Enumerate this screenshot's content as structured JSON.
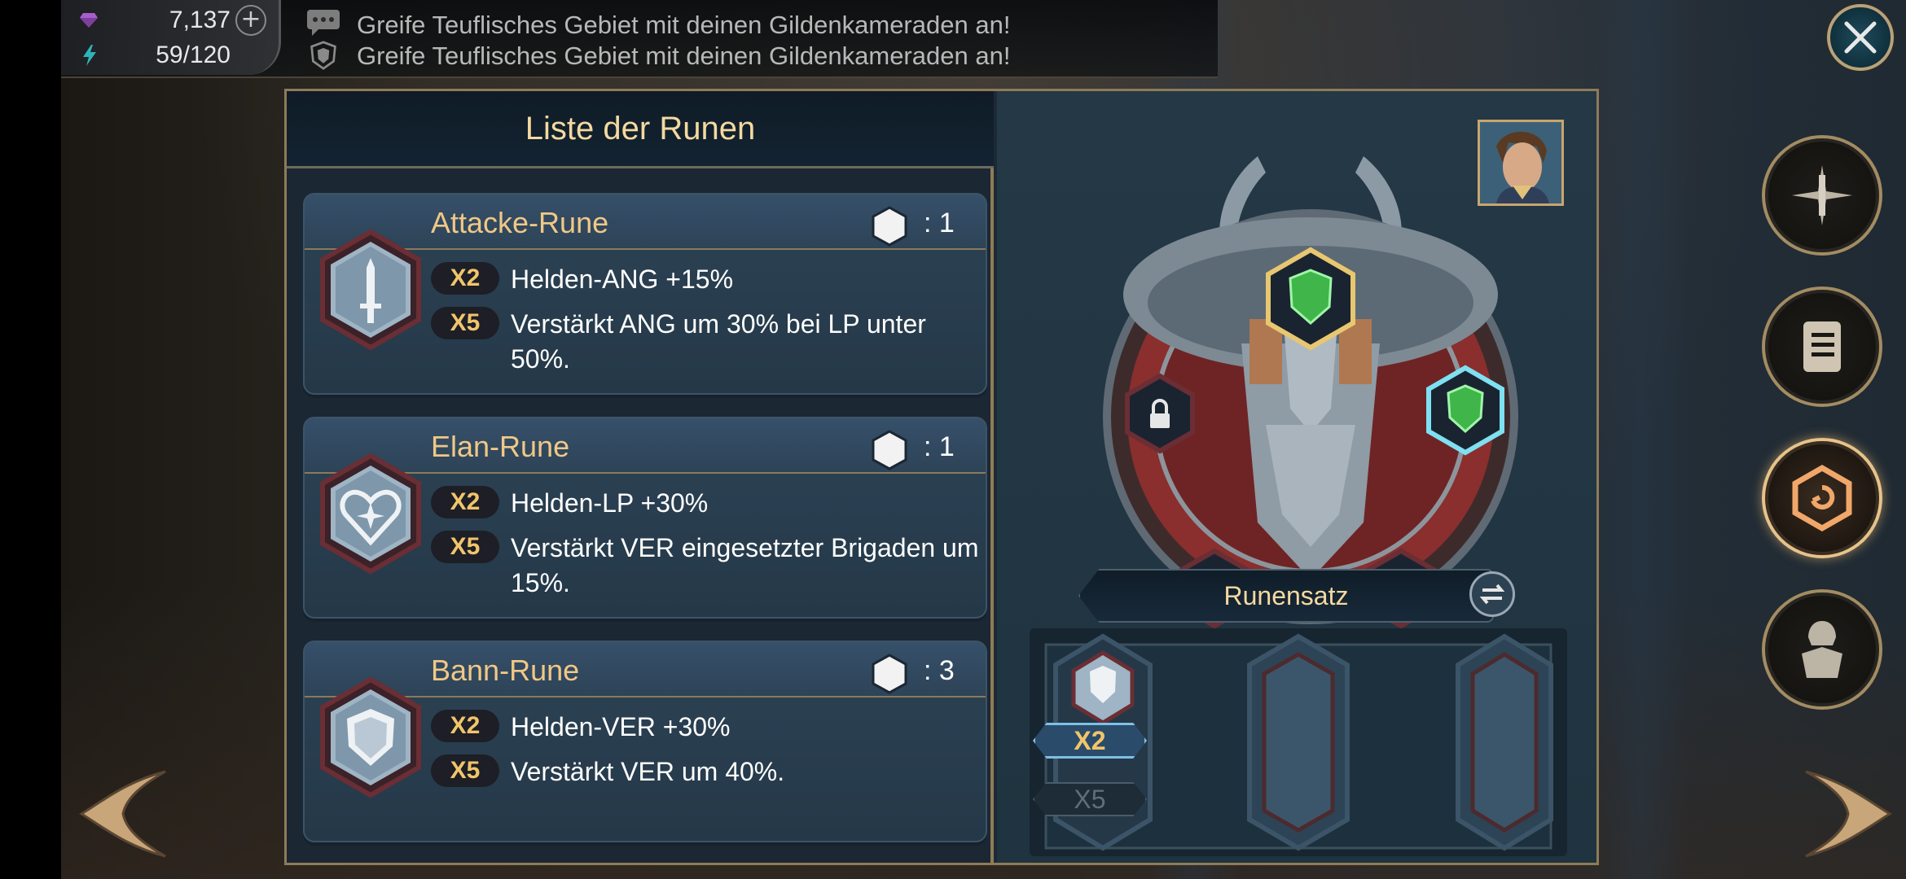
{
  "status": {
    "gems": "7,137",
    "energy": "59/120",
    "plus_symbol": "+"
  },
  "chat": {
    "line1": "Greife Teuflisches Gebiet mit deinen Gildenkameraden an!",
    "line2": "Greife Teuflisches Gebiet mit deinen Gildenkameraden an!"
  },
  "rune_list": {
    "title": "Liste der Runen",
    "runes": [
      {
        "name": "Attacke-Rune",
        "count": ": 1",
        "icon": "sword-icon",
        "bonus": [
          {
            "tag": "X2",
            "text": "Helden-ANG +15%"
          },
          {
            "tag": "X5",
            "text": "Verstärkt ANG um 30% bei LP unter 50%."
          }
        ]
      },
      {
        "name": "Elan-Rune",
        "count": ": 1",
        "icon": "heart-icon",
        "bonus": [
          {
            "tag": "X2",
            "text": "Helden-LP +30%"
          },
          {
            "tag": "X5",
            "text": "Verstärkt VER eingesetzter Brigaden um 15%."
          }
        ]
      },
      {
        "name": "Bann-Rune",
        "count": ": 3",
        "icon": "shield-icon",
        "bonus": [
          {
            "tag": "X2",
            "text": "Helden-VER +30%"
          },
          {
            "tag": "X5",
            "text": "Verstärkt VER um 40%."
          }
        ]
      }
    ]
  },
  "rune_set": {
    "label": "Runensatz",
    "tag_x2": "X2",
    "tag_x5": "X5"
  },
  "side_buttons": [
    "crossed-swords-icon",
    "scroll-icon",
    "rune-icon",
    "knight-icon"
  ],
  "colors": {
    "accent_gold": "#f4d9a0",
    "title_orange": "#f0c886",
    "rune_green": "#3fb54a",
    "frame_gold": "#8f7b58"
  }
}
